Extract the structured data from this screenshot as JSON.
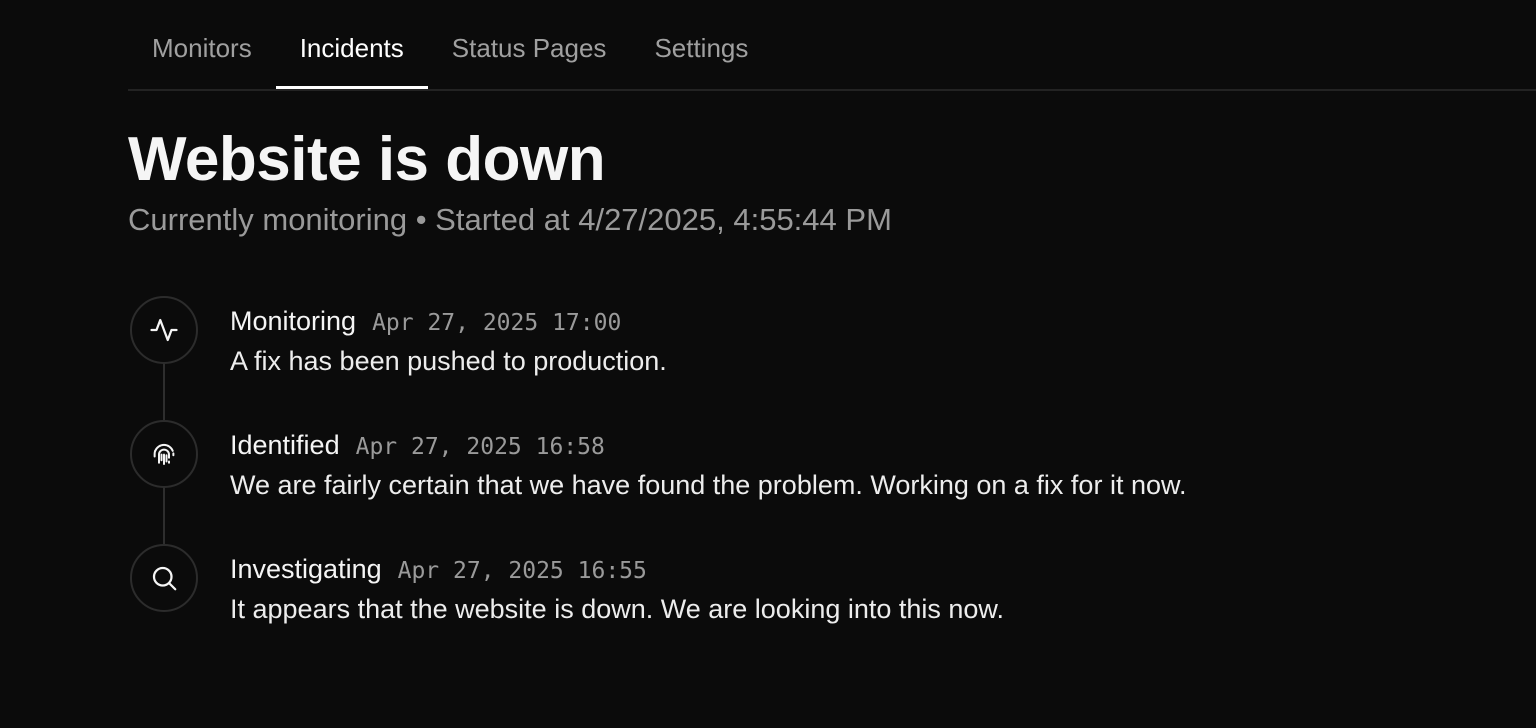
{
  "tabs": [
    {
      "label": "Monitors",
      "active": false
    },
    {
      "label": "Incidents",
      "active": true
    },
    {
      "label": "Status Pages",
      "active": false
    },
    {
      "label": "Settings",
      "active": false
    }
  ],
  "incident": {
    "title": "Website is down",
    "subtitle": "Currently monitoring • Started at 4/27/2025, 4:55:44 PM"
  },
  "timeline": [
    {
      "status": "Monitoring",
      "time": "Apr 27, 2025 17:00",
      "message": "A fix has been pushed to production.",
      "icon": "activity-icon"
    },
    {
      "status": "Identified",
      "time": "Apr 27, 2025 16:58",
      "message": "We are fairly certain that we have found the problem. Working on a fix for it now.",
      "icon": "fingerprint-icon"
    },
    {
      "status": "Investigating",
      "time": "Apr 27, 2025 16:55",
      "message": "It appears that the website is down. We are looking into this now.",
      "icon": "search-icon"
    }
  ],
  "colors": {
    "background": "#0b0b0b",
    "text": "#f5f5f5",
    "muted": "#9a9a9a",
    "border": "#2c2c2c"
  }
}
